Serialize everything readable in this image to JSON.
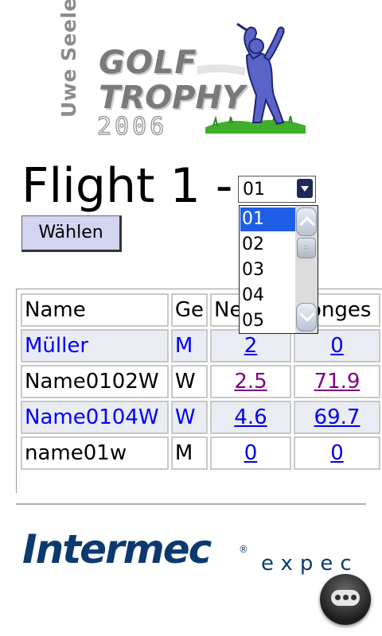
{
  "logo": {
    "vertical_text": "Uwe Seeler",
    "line1": "GOLF",
    "line2": "TROPHY",
    "year": "2006",
    "icon": "golfer-icon"
  },
  "heading": "Flight 1 -",
  "flight_select": {
    "selected": "01",
    "options": [
      "01",
      "02",
      "03",
      "04",
      "05"
    ],
    "highlighted": "01"
  },
  "choose_button": "Wählen",
  "table": {
    "headers": [
      "Name",
      "Ge",
      "Ne",
      "Longes"
    ],
    "rows": [
      {
        "name": "Müller",
        "gender": "M",
        "net": "2",
        "longest": "0",
        "style": "blue-shaded",
        "visited": false
      },
      {
        "name": "Name0102W",
        "gender": "W",
        "net": "2.5",
        "longest": "71.9",
        "style": "plain",
        "visited": true
      },
      {
        "name": "Name0104W",
        "gender": "W",
        "net": "4.6",
        "longest": "69.7",
        "style": "blue-shaded",
        "visited": false
      },
      {
        "name": "name01w",
        "gender": "M",
        "net": "0",
        "longest": "0",
        "style": "plain",
        "visited": false
      }
    ]
  },
  "footer": {
    "brand": "Intermec",
    "tagline": "expec",
    "menu_icon": "menu-dots-icon"
  },
  "colors": {
    "link": "#0000ee",
    "visited_link": "#800080",
    "button_bg": "#d2d4f2",
    "brand_blue": "#0c3a6e",
    "selection": "#1e5ee6"
  }
}
